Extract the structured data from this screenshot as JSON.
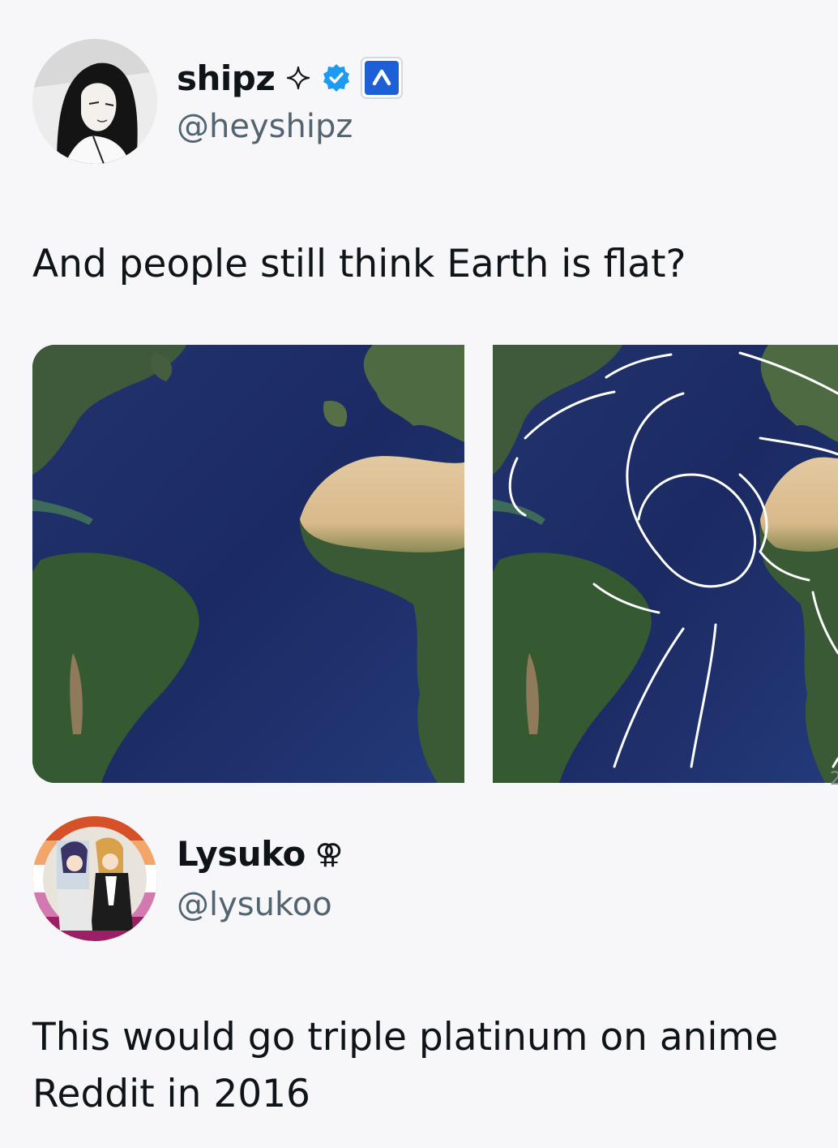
{
  "post": {
    "author": {
      "name": "shipz",
      "name_icon": "sparkle-icon",
      "handle": "@heyshipz",
      "badges": [
        "verified-badge-icon",
        "affiliate-badge-icon"
      ]
    },
    "text": "And people still think Earth is flat?",
    "media": [
      {
        "name": "atlantic-map-image"
      },
      {
        "name": "atlantic-map-annotated-image"
      }
    ],
    "media_edge_text": "2"
  },
  "reply": {
    "author": {
      "name": "Lysuko",
      "name_icon": "double-venus-icon",
      "name_symbol": "⚢",
      "handle": "@lysukoo"
    },
    "text_line1": "This would go triple platinum on anime",
    "text_line2": "Reddit in 2016"
  },
  "colors": {
    "verified": "#1d9bf0",
    "affiliate": "#1d5fd6",
    "handle": "#536471"
  }
}
